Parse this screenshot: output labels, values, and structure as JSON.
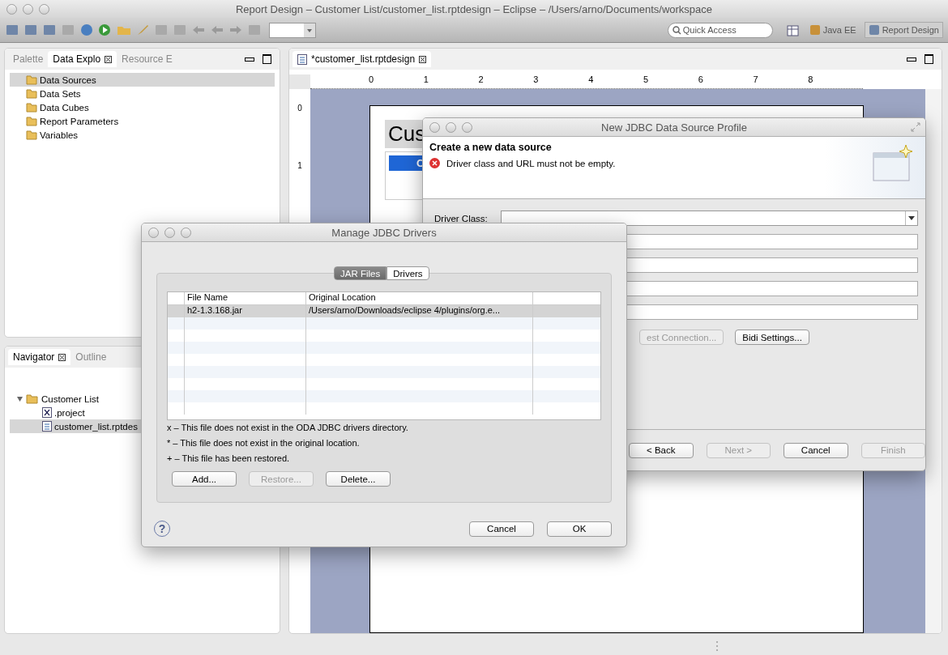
{
  "window": {
    "title": "Report Design – Customer List/customer_list.rptdesign – Eclipse – /Users/arno/Documents/workspace"
  },
  "toolbar": {
    "quick_access": {
      "placeholder": "Quick Access"
    },
    "perspectives": [
      {
        "label": "Java EE",
        "selected": false
      },
      {
        "label": "Report Design",
        "selected": true
      }
    ]
  },
  "explorer": {
    "tabs": [
      {
        "label": "Palette",
        "selected": false
      },
      {
        "label": "Data Explo",
        "selected": true
      },
      {
        "label": "Resource E",
        "selected": false
      }
    ],
    "items": [
      {
        "label": "Data Sources",
        "selected": true
      },
      {
        "label": "Data Sets",
        "selected": false
      },
      {
        "label": "Data Cubes",
        "selected": false
      },
      {
        "label": "Report Parameters",
        "selected": false
      },
      {
        "label": "Variables",
        "selected": false
      }
    ]
  },
  "navigator": {
    "tabs": [
      {
        "label": "Navigator",
        "selected": true
      },
      {
        "label": "Outline",
        "selected": false
      }
    ],
    "tree": [
      {
        "label": "Customer List",
        "kind": "project",
        "expanded": true,
        "selected": false,
        "children": [
          {
            "label": ".project",
            "kind": "xml",
            "selected": false
          },
          {
            "label": "customer_list.rptdes",
            "kind": "report",
            "selected": true
          }
        ]
      }
    ]
  },
  "editor": {
    "tab": "*customer_list.rptdesign",
    "ruler": [
      "0",
      "1",
      "2",
      "3",
      "4",
      "5",
      "6",
      "7",
      "8"
    ],
    "vruler": [
      "0",
      "1"
    ],
    "report_title": "Cus",
    "report_cell": "C"
  },
  "jdbc_dialog": {
    "title": "New JDBC Data Source Profile",
    "heading": "Create a new data source",
    "error": "Driver class and URL must not be empty.",
    "driver_class_label": "Driver Class:",
    "buttons": [
      {
        "label": "est Connection...",
        "disabled": true
      },
      {
        "label": "Bidi Settings...",
        "disabled": false
      }
    ],
    "nav_buttons": [
      {
        "label": "< Back",
        "disabled": false
      },
      {
        "label": "Next >",
        "disabled": true
      },
      {
        "label": "Cancel",
        "disabled": false
      },
      {
        "label": "Finish",
        "disabled": true
      }
    ]
  },
  "manage_dialog": {
    "title": "Manage JDBC Drivers",
    "tabs": [
      {
        "label": "JAR Files",
        "selected": true
      },
      {
        "label": "Drivers",
        "selected": false
      }
    ],
    "columns": [
      "File Name",
      "Original Location"
    ],
    "rows": [
      {
        "cells": [
          "h2-1.3.168.jar",
          "/Users/arno/Downloads/eclipse 4/plugins/org.e..."
        ],
        "selected": true
      }
    ],
    "legend": [
      "x – This file does not exist in the ODA JDBC drivers directory.",
      "* – This file does not exist in the original location.",
      "+ – This file has been restored."
    ],
    "buttons": [
      {
        "label": "Add...",
        "disabled": false
      },
      {
        "label": "Restore...",
        "disabled": true
      },
      {
        "label": "Delete...",
        "disabled": false
      }
    ],
    "footer_buttons": [
      "Cancel",
      "OK"
    ],
    "help_label": "?"
  }
}
